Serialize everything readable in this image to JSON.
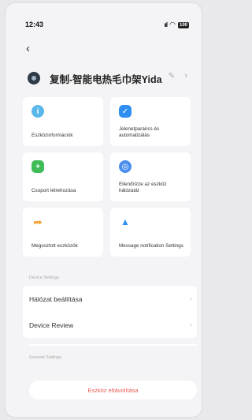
{
  "status": {
    "time": "12:43",
    "battery": "100"
  },
  "device": {
    "name": "复制-智能电热毛巾架Yida"
  },
  "cards": [
    {
      "label": "Eszközinformációk",
      "icon": "info-icon",
      "color": "#5ab7ea",
      "glyph": "i"
    },
    {
      "label": "Jelenetparancs és automatizálás",
      "icon": "check-icon",
      "color": "#2f8ff0",
      "glyph": "✓"
    },
    {
      "label": "Csoport létrehozása",
      "icon": "group-add-icon",
      "color": "#3fbb57",
      "glyph": "+"
    },
    {
      "label": "Ellenőrizze az eszköz hálózatát",
      "icon": "network-check-icon",
      "color": "#4a8ff0",
      "glyph": "◎"
    },
    {
      "label": "Megosztott eszközök",
      "icon": "share-icon",
      "color": "#f6a43a",
      "glyph": "➦"
    },
    {
      "label": "Message notification Settings",
      "icon": "bell-icon",
      "color": "#2f8ff0",
      "glyph": "🔔"
    }
  ],
  "device_settings": {
    "title": "Device Settings",
    "items": [
      {
        "label": "Hálózat beállítása"
      },
      {
        "label": "Device Review"
      }
    ]
  },
  "general_settings": {
    "title": "General Settings"
  },
  "remove_label": "Eszköz eltávolítása"
}
